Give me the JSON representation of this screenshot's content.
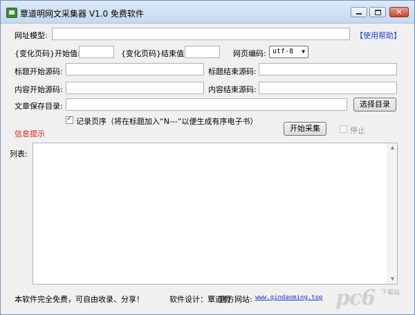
{
  "window": {
    "title": "覃道明网文采集器 V1.0   免费软件",
    "close_glyph": "✕"
  },
  "form": {
    "url_template_label": "网址模型:",
    "url_template_value": "",
    "help_link": "【使用帮助】",
    "page_start_label": "{变化页码}开始值:",
    "page_start_value": "",
    "page_end_label": "{变化页码}结束值:",
    "page_end_value": "",
    "encoding_label": "网页编码:",
    "encoding_value": "utf-8",
    "title_start_label": "标题开始源码:",
    "title_start_value": "",
    "title_end_label": "标题结束源码:",
    "title_end_value": "",
    "content_start_label": "内容开始源码:",
    "content_start_value": "",
    "content_end_label": "内容结束源码:",
    "content_end_value": "",
    "save_dir_label": "文章保存目录:",
    "save_dir_value": "",
    "choose_dir_button": "选择目录",
    "record_page_checkbox_label": "记录页序（将在标题加入“N---”以便生成有序电子书）",
    "record_page_checked": true,
    "start_button": "开始采集",
    "stop_label": "停止",
    "stop_checked": false,
    "info_hint": "信息提示"
  },
  "list": {
    "label": "列表:",
    "items": []
  },
  "footer": {
    "free_notice": "本软件完全免费，可自由收录、分享！",
    "designer": "软件设计：覃道明",
    "website_label": "官方网站:",
    "website_url": "www.qindaoming.top"
  },
  "watermark": {
    "text": "pc6",
    "sub": "下载站"
  }
}
